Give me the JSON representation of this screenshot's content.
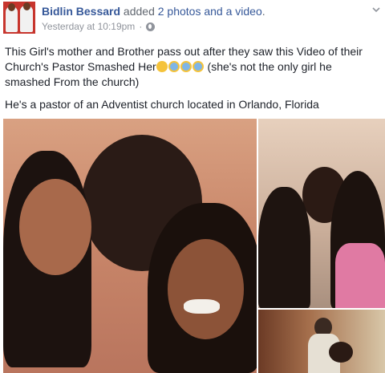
{
  "header": {
    "author": "Bidlin Bessard",
    "action_prefix": "added",
    "action_link": "2 photos and a video",
    "action_suffix": ".",
    "timestamp": "Yesterday at 10:19pm",
    "separator": "·",
    "privacy_icon": "globe-icon",
    "menu_icon": "chevron-down-icon"
  },
  "post": {
    "text_part1": "This Girl's mother and Brother pass out after they saw this Video of their Church's Pastor Smashed Her",
    "text_part2": " (she's not the only girl he smashed From the church)",
    "emojis": [
      "flushed-face",
      "screaming-face",
      "screaming-face",
      "screaming-face"
    ],
    "text_line2": "He's a pastor of an Adventist church located in Orlando, Florida"
  },
  "colors": {
    "link": "#365899",
    "meta": "#90949c",
    "text": "#1d2129"
  }
}
